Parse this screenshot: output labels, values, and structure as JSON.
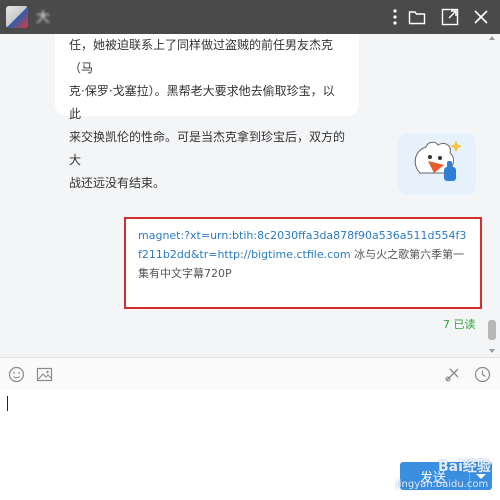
{
  "window": {
    "title": "大",
    "icons": [
      "more-icon",
      "folder-icon",
      "popout-icon",
      "close-icon"
    ]
  },
  "chat": {
    "received_message_lines": [
      "任，她被迫联系上了同样做过盗贼的前任男友杰克（马",
      "克·保罗·戈塞拉）。黑帮老大要求他去偷取珍宝，以此",
      "来交换凯伦的性命。可是当杰克拿到珍宝后，双方的大",
      "战还远没有结束。"
    ],
    "sticker_icon": "thumbs-up-sticker-icon",
    "sent_message": {
      "link": "magnet:?xt=urn:btih:8c2030ffa3da878f90a536a511d554f3f211b2dd&tr=http://bigtime.ctfile.com",
      "text": " 冰与火之歌第六季第一集有中文字幕720P"
    },
    "read_status": "7 已读"
  },
  "toolbar": {
    "left_icons": [
      "emoji-icon",
      "image-icon"
    ],
    "right_icons": [
      "screenshot-icon",
      "history-icon"
    ]
  },
  "input": {
    "value": "",
    "send_label": "发送"
  },
  "watermark": {
    "text": "Bai经验",
    "url": "jingyan.baidu.com"
  },
  "colors": {
    "titlebar": "#4a4a4a",
    "chat_bg": "#f4f5f7",
    "link": "#2a7bc0",
    "highlight_border": "#d42f2f",
    "read_status": "#35a637",
    "send_button": "#3b8fe0"
  }
}
